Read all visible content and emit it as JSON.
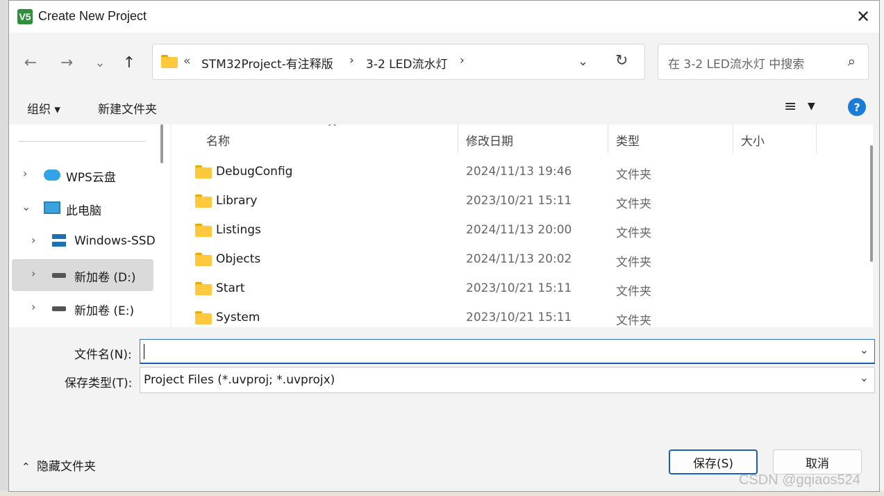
{
  "window": {
    "title": "Create New Project",
    "app_icon_text": "V5"
  },
  "nav": {
    "back_icon": "←",
    "forward_icon": "→",
    "recent_icon": "⌄",
    "up_icon": "↑",
    "breadcrumb_prefix": "«",
    "breadcrumbs": [
      "STM32Project-有注释版",
      "3-2 LED流水灯"
    ],
    "breadcrumb_sep": "›",
    "search_placeholder": "在 3-2 LED流水灯 中搜索"
  },
  "toolbar": {
    "organize": "组织 ▾",
    "new_folder": "新建文件夹",
    "help": "?"
  },
  "sidebar": {
    "items": [
      {
        "label": "WPS云盘",
        "chevron": "›"
      },
      {
        "label": "此电脑",
        "chevron": "⌄"
      },
      {
        "label": "Windows-SSD",
        "chevron": "›"
      },
      {
        "label": "新加卷 (D:)",
        "chevron": "›"
      },
      {
        "label": "新加卷 (E:)",
        "chevron": "›"
      }
    ]
  },
  "files": {
    "columns": [
      "名称",
      "修改日期",
      "类型",
      "大小"
    ],
    "sort_indicator": "^",
    "rows": [
      {
        "name": "DebugConfig",
        "date": "2024/11/13 19:46",
        "type": "文件夹"
      },
      {
        "name": "Library",
        "date": "2023/10/21 15:11",
        "type": "文件夹"
      },
      {
        "name": "Listings",
        "date": "2024/11/13 20:00",
        "type": "文件夹"
      },
      {
        "name": "Objects",
        "date": "2024/11/13 20:02",
        "type": "文件夹"
      },
      {
        "name": "Start",
        "date": "2023/10/21 15:11",
        "type": "文件夹"
      },
      {
        "name": "System",
        "date": "2023/10/21 15:11",
        "type": "文件夹"
      }
    ]
  },
  "form": {
    "filename_label": "文件名(N):",
    "filename_value": "",
    "filetype_label": "保存类型(T):",
    "filetype_value": "Project Files (*.uvproj; *.uvprojx)"
  },
  "footer": {
    "hide_folders": "隐藏文件夹",
    "save": "保存(S)",
    "cancel": "取消"
  },
  "watermark": "CSDN @gqiaos524",
  "colors": {
    "accent": "#1a5fb4",
    "folder": "#ffc83d",
    "selection": "#dadada"
  }
}
